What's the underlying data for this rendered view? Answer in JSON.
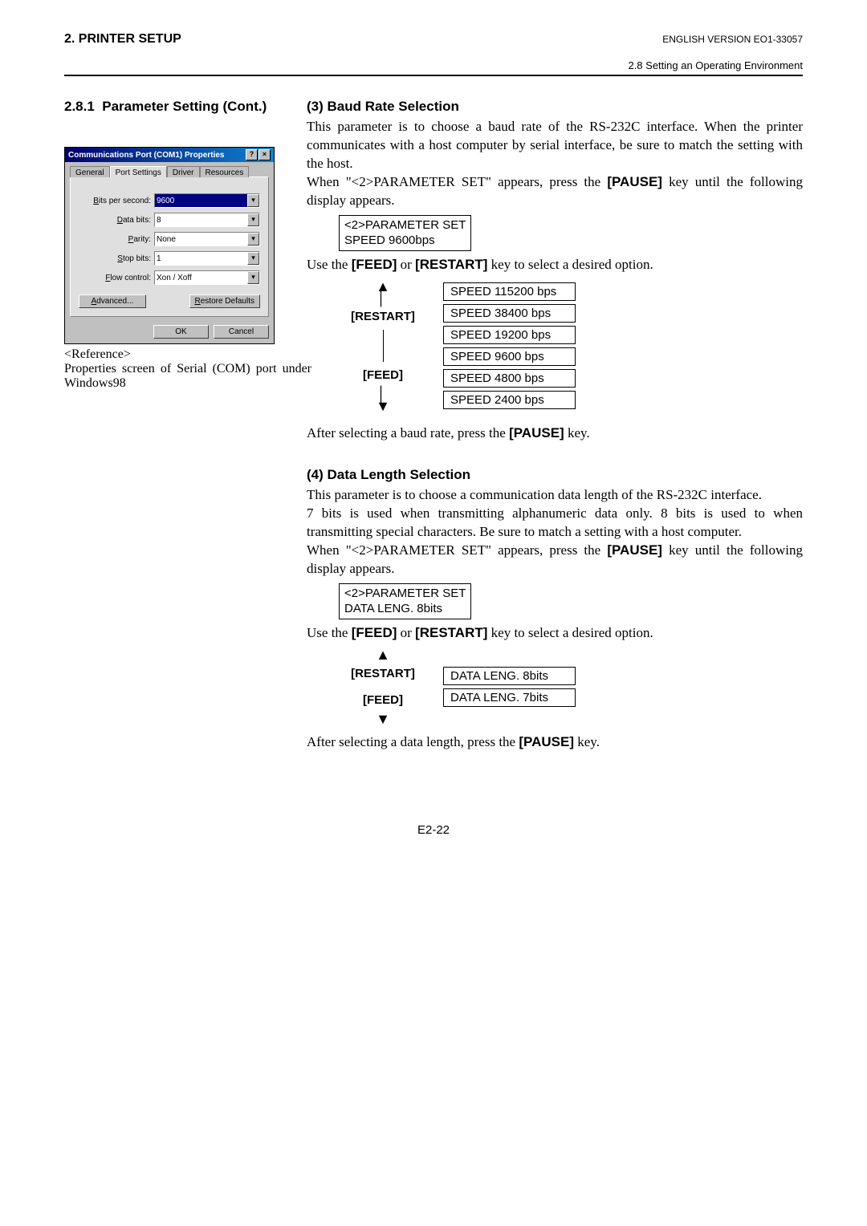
{
  "header": {
    "chapter": "2. PRINTER SETUP",
    "version": "ENGLISH VERSION EO1-33057",
    "section_path": "2.8 Setting an Operating Environment"
  },
  "left": {
    "heading_num": "2.8.1",
    "heading": "Parameter Setting (Cont.)",
    "dialog": {
      "title": "Communications Port (COM1) Properties",
      "tabs": [
        "General",
        "Port Settings",
        "Driver",
        "Resources"
      ],
      "fields": {
        "bps_label": "Bits per second:",
        "bps_value": "9600",
        "databits_label": "Data bits:",
        "databits_value": "8",
        "parity_label": "Parity:",
        "parity_value": "None",
        "stopbits_label": "Stop bits:",
        "stopbits_value": "1",
        "flow_label": "Flow control:",
        "flow_value": "Xon / Xoff"
      },
      "advanced_btn": "Advanced...",
      "restore_btn": "Restore Defaults",
      "ok_btn": "OK",
      "cancel_btn": "Cancel"
    },
    "caption_title": "<Reference>",
    "caption_body": "Properties screen of Serial (COM) port under Windows98"
  },
  "sec3": {
    "title": "(3)  Baud Rate Selection",
    "para1": "This parameter is to choose a baud rate of the RS-232C interface.  When the printer communicates with a host computer by serial interface, be sure to match the setting with the host.",
    "para2_pre": "When \"<2>PARAMETER SET\" appears, press the ",
    "para2_key": "[PAUSE]",
    "para2_post": " key until the following display appears.",
    "lcd_line1": "<2>PARAMETER SET",
    "lcd_line2": "SPEED  9600bps",
    "use_pre": "Use the ",
    "use_k1": "[FEED]",
    "use_mid": " or ",
    "use_k2": "[RESTART]",
    "use_post": " key to select a desired option.",
    "restart_label": "[RESTART]",
    "feed_label": "[FEED]",
    "options": [
      "SPEED  115200 bps",
      "SPEED  38400 bps",
      "SPEED  19200 bps",
      "SPEED   9600 bps",
      "SPEED   4800 bps",
      "SPEED   2400 bps"
    ],
    "after_pre": "After selecting a baud rate, press the ",
    "after_key": "[PAUSE]",
    "after_post": " key."
  },
  "sec4": {
    "title": "(4)  Data Length Selection",
    "para1": "This parameter is to choose a communication data length of the RS-232C interface.",
    "para2": "7 bits is used when transmitting alphanumeric data only.  8 bits is used to when transmitting special characters.  Be sure to match a setting with a host computer.",
    "para3_pre": "When \"<2>PARAMETER SET\" appears, press the ",
    "para3_key": "[PAUSE]",
    "para3_post": " key until the following display appears.",
    "lcd_line1": "<2>PARAMETER SET",
    "lcd_line2": "DATA LENG. 8bits",
    "use_pre": "Use the ",
    "use_k1": "[FEED]",
    "use_mid": " or ",
    "use_k2": "[RESTART]",
    "use_post": " key to select a desired option.",
    "restart_label": "[RESTART]",
    "feed_label": "[FEED]",
    "options": [
      "DATA LENG. 8bits",
      "DATA LENG. 7bits"
    ],
    "after_pre": "After selecting a data length, press the ",
    "after_key": "[PAUSE]",
    "after_post": " key."
  },
  "page_number": "E2-22"
}
